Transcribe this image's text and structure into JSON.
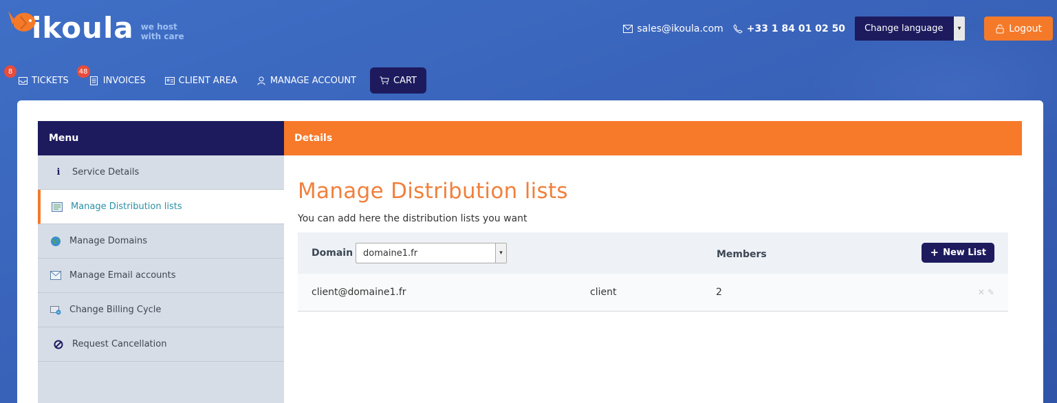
{
  "brand": {
    "name": "ikoula",
    "tagline_line1": "we host",
    "tagline_line2": "with care"
  },
  "header": {
    "email": "sales@ikoula.com",
    "phone": "+33 1 84 01 02 50",
    "language_label": "Change language",
    "logout_label": "Logout"
  },
  "nav": {
    "tickets": {
      "label": "TICKETS",
      "badge": "8"
    },
    "invoices": {
      "label": "INVOICES",
      "badge": "48"
    },
    "client_area": {
      "label": "CLIENT AREA"
    },
    "manage_account": {
      "label": "MANAGE ACCOUNT"
    },
    "cart": {
      "label": "CART"
    }
  },
  "sidebar": {
    "title": "Menu",
    "items": [
      {
        "label": "Service Details",
        "icon": "info-icon"
      },
      {
        "label": "Manage Distribution lists",
        "icon": "list-icon",
        "active": true
      },
      {
        "label": "Manage Domains",
        "icon": "globe-icon"
      },
      {
        "label": "Manage Email accounts",
        "icon": "envelope-icon"
      },
      {
        "label": "Change Billing Cycle",
        "icon": "billing-icon"
      },
      {
        "label": "Request Cancellation",
        "icon": "cancel-icon"
      }
    ]
  },
  "details": {
    "header": "Details",
    "title": "Manage Distribution lists",
    "subtitle": "You can add here the distribution lists you want",
    "domain_label": "Domain",
    "domain_value": "domaine1.fr",
    "members_label": "Members",
    "new_list_label": "New List",
    "rows": [
      {
        "email": "client@domaine1.fr",
        "name": "client",
        "members": "2"
      }
    ]
  },
  "colors": {
    "accent_orange": "#f47a2a",
    "navy": "#1d1b5e",
    "background_blue": "#3a64bb"
  }
}
